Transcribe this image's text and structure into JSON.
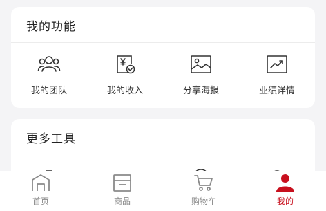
{
  "functions": {
    "title": "我的功能",
    "items": [
      {
        "label": "我的团队",
        "icon": "team-icon"
      },
      {
        "label": "我的收入",
        "icon": "income-icon"
      },
      {
        "label": "分享海报",
        "icon": "poster-icon"
      },
      {
        "label": "业绩详情",
        "icon": "performance-icon"
      }
    ]
  },
  "tools": {
    "title": "更多工具"
  },
  "tabbar": {
    "tabs": [
      {
        "label": "首页",
        "icon": "home-icon",
        "active": false
      },
      {
        "label": "商品",
        "icon": "goods-icon",
        "active": false
      },
      {
        "label": "购物车",
        "icon": "cart-icon",
        "active": false
      },
      {
        "label": "我的",
        "icon": "profile-icon",
        "active": true
      }
    ]
  },
  "colors": {
    "accent": "#c8101e",
    "inactive_tab": "#8a8a8a",
    "background": "#f4f4f6"
  }
}
